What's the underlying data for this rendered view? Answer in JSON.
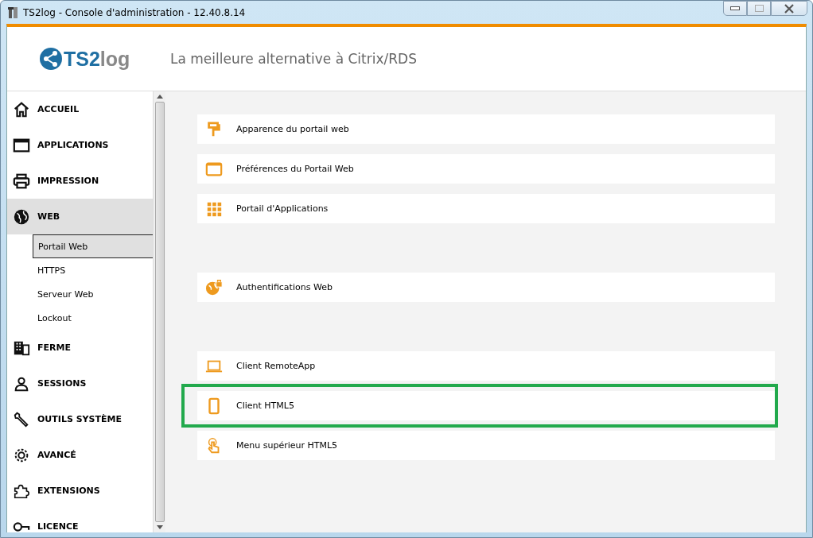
{
  "window": {
    "title": "TS2log - Console d'administration - 12.40.8.14"
  },
  "header": {
    "logo": {
      "first": "TS2",
      "second": "log"
    },
    "tagline": "La meilleure alternative à Citrix/RDS"
  },
  "sidebar": {
    "items": [
      {
        "kind": "section",
        "label": "ACCUEIL",
        "selected": false
      },
      {
        "kind": "section",
        "label": "APPLICATIONS",
        "selected": false
      },
      {
        "kind": "section",
        "label": "IMPRESSION",
        "selected": false
      },
      {
        "kind": "section",
        "label": "WEB",
        "selected": true
      },
      {
        "kind": "sub",
        "label": "Portail Web",
        "selected": true
      },
      {
        "kind": "sub",
        "label": "HTTPS",
        "selected": false
      },
      {
        "kind": "sub",
        "label": "Serveur Web",
        "selected": false
      },
      {
        "kind": "sub",
        "label": "Lockout",
        "selected": false
      },
      {
        "kind": "section",
        "label": "FERME",
        "selected": false
      },
      {
        "kind": "section",
        "label": "SESSIONS",
        "selected": false
      },
      {
        "kind": "section",
        "label": "OUTILS SYSTÈME",
        "selected": false
      },
      {
        "kind": "section",
        "label": "AVANCÉ",
        "selected": false
      },
      {
        "kind": "section",
        "label": "EXTENSIONS",
        "selected": false
      },
      {
        "kind": "section",
        "label": "LICENCE",
        "selected": false
      }
    ]
  },
  "content": {
    "groups": [
      [
        {
          "label": "Apparence du portail web",
          "highlighted": false
        },
        {
          "label": "Préférences du Portail Web",
          "highlighted": false
        },
        {
          "label": "Portail d'Applications",
          "highlighted": false
        }
      ],
      [
        {
          "label": "Authentifications Web",
          "highlighted": false
        }
      ],
      [
        {
          "label": "Client RemoteApp",
          "highlighted": false
        },
        {
          "label": "Client HTML5",
          "highlighted": true
        },
        {
          "label": "Menu supérieur HTML5",
          "highlighted": false
        }
      ]
    ]
  }
}
